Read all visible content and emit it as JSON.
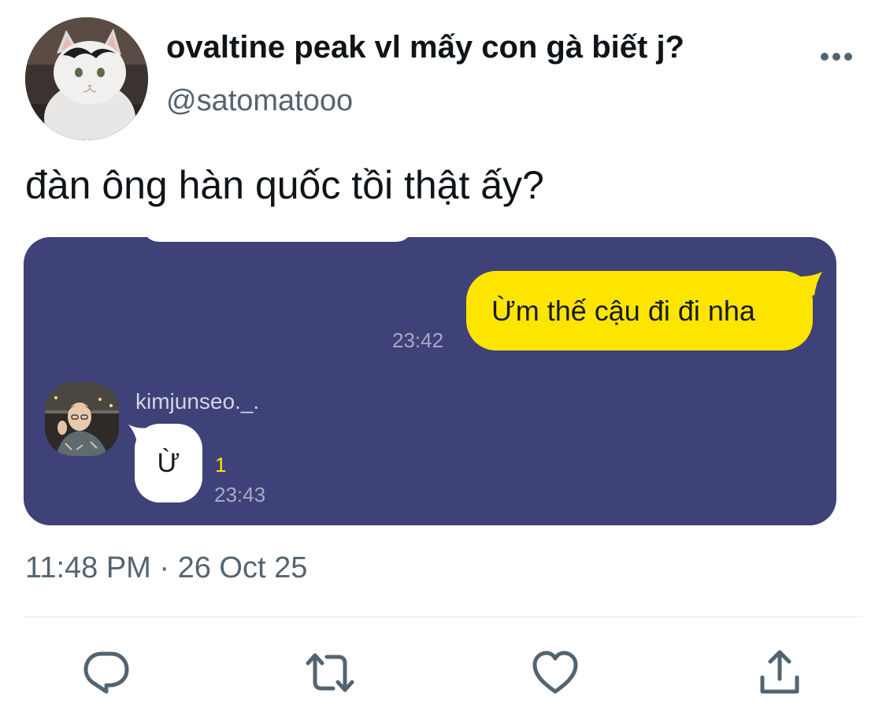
{
  "tweet": {
    "author": {
      "display_name": "ovaltine peak vl mấy con gà biết j?",
      "handle": "@satomatooo"
    },
    "text": "đàn ông hàn quốc tồi thật ấy?",
    "timestamp": "11:48 PM · 26 Oct 25"
  },
  "chat": {
    "outgoing": {
      "text": "Ừm thế cậu đi đi nha",
      "time": "23:42"
    },
    "incoming": {
      "sender": "kimjunseo._.",
      "text": "Ừ",
      "unread": "1",
      "time": "23:43"
    }
  },
  "actions": {
    "reply_icon": "reply-icon",
    "retweet_icon": "retweet-icon",
    "like_icon": "heart-icon",
    "share_icon": "share-icon"
  },
  "colors": {
    "chat_background": "#3f4278",
    "outgoing_bubble": "#fee500",
    "muted_text": "#536471",
    "icon_gray": "#536471"
  }
}
